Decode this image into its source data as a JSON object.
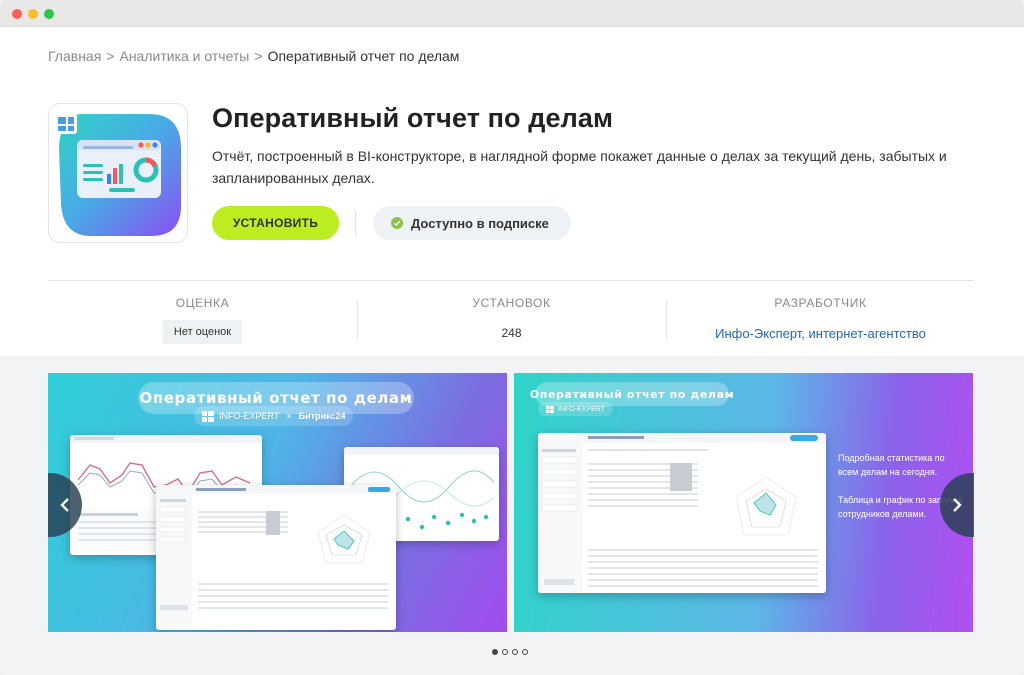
{
  "breadcrumb": {
    "home": "Главная",
    "category": "Аналитика и отчеты",
    "separator": ">",
    "current": "Оперативный отчет по делам"
  },
  "app": {
    "title": "Оперативный отчет по делам",
    "description": "Отчёт, построенный в BI-конструкторе, в наглядной форме покажет данные о делах за текущий день, забытых и запланированных делах.",
    "install_label": "УСТАНОВИТЬ",
    "subscription_label": "Доступно в подписке",
    "icon": "dashboard-app-icon"
  },
  "stats": {
    "rating_label": "ОЦЕНКА",
    "rating_value": "Нет оценок",
    "installs_label": "УСТАНОВОК",
    "installs_value": "248",
    "developer_label": "РАЗРАБОТЧИК",
    "developer_value": "Инфо-Эксперт, интернет-агентство"
  },
  "gallery": {
    "slide1": {
      "title": "Оперативный отчет по делам",
      "brand_left": "INFO-EXPERT",
      "brand_x": "×",
      "brand_right": "Битрикс24"
    },
    "slide2": {
      "title": "Оперативный отчет по делам",
      "brand": "INFO-EXPERT",
      "text1": "Подробная статистика по всем делам на сегодня.",
      "text2": "Таблица и график по загрузке сотрудников делами."
    },
    "prev_icon": "chevron-left-icon",
    "next_icon": "chevron-right-icon",
    "active_dot": 0,
    "dot_count": 4
  },
  "colors": {
    "install_button": "#bbed21",
    "link": "#2067b0",
    "subscription_check": "#8bc34a"
  }
}
